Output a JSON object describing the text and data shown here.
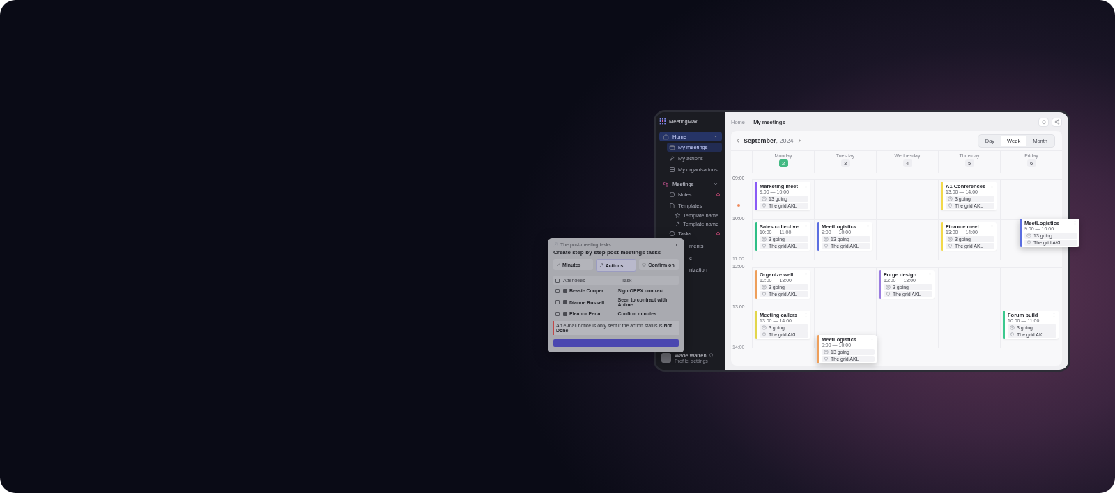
{
  "sidebar": {
    "logo": "MeetingMax",
    "nav": [
      {
        "label": "Home",
        "selected": true,
        "expanded": true,
        "children": [
          {
            "label": "My meetings",
            "selected": true,
            "alert": false
          },
          {
            "label": "My actions",
            "selected": false,
            "alert": false
          },
          {
            "label": "My organisations",
            "selected": false,
            "alert": false
          }
        ]
      },
      {
        "label": "Meetings",
        "selected": false,
        "expanded": true,
        "children": [
          {
            "label": "Notes",
            "selected": false,
            "alert": true
          },
          {
            "label": "Templates",
            "selected": false,
            "alert": false,
            "children": [
              {
                "label": "Template name"
              },
              {
                "label": "Template name"
              }
            ]
          },
          {
            "label": "Tasks",
            "selected": false,
            "alert": true
          }
        ]
      }
    ],
    "items_behind_dialog": [
      "ments",
      "e",
      "nization"
    ],
    "user": {
      "name": "Wade Warren",
      "subtitle": "Profile, settings"
    }
  },
  "breadcrumb": {
    "items": [
      "Home",
      "My meetings"
    ],
    "separator": "–"
  },
  "calendar": {
    "month": "September",
    "year": ", 2024",
    "views": [
      {
        "label": "Day",
        "selected": false
      },
      {
        "label": "Week",
        "selected": true
      },
      {
        "label": "Month",
        "selected": false
      }
    ],
    "days": [
      {
        "name": "Monday",
        "date": "2",
        "today": true
      },
      {
        "name": "Tuesday",
        "date": "3",
        "today": false
      },
      {
        "name": "Wednesday",
        "date": "4",
        "today": false
      },
      {
        "name": "Thursday",
        "date": "5",
        "today": false
      },
      {
        "name": "Friday",
        "date": "6",
        "today": false
      }
    ],
    "rows": [
      {
        "time": "09:00",
        "collapsed": false,
        "now": true,
        "slots": [
          {
            "kind": "event",
            "title": "Marketing meet",
            "time": "9:00 — 10:00",
            "attendees": "13 going",
            "location": "The grid AKL",
            "color": "#8b5cf6",
            "floating": false
          },
          {
            "kind": "empty"
          },
          {
            "kind": "empty"
          },
          {
            "kind": "event",
            "title": "A1 Conferences",
            "time": "13:00 — 14:00",
            "attendees": "3 going",
            "location": "The grid AKL",
            "color": "#f2d94a",
            "floating": false
          },
          {
            "kind": "empty"
          }
        ]
      },
      {
        "time": "10:00",
        "collapsed": false,
        "now": false,
        "slots": [
          {
            "kind": "event",
            "title": "Sales collective",
            "time": "10:00 — 11:00",
            "attendees": "3 going",
            "location": "The grid AKL",
            "color": "#2fbf86",
            "floating": false
          },
          {
            "kind": "event",
            "title": "MeetLogistics",
            "time": "9:00 — 10:00",
            "attendees": "13 going",
            "location": "The grid AKL",
            "color": "#5b6ee1",
            "floating": false
          },
          {
            "kind": "empty"
          },
          {
            "kind": "event",
            "title": "Finance meet",
            "time": "13:00 — 14:00",
            "attendees": "3 going",
            "location": "The grid AKL",
            "color": "#f2d94a",
            "floating": false
          },
          {
            "kind": "event",
            "title": "MeetLogistics",
            "time": "9:00 — 10:00",
            "attendees": "13 going",
            "location": "The grid AKL",
            "color": "#5b6ee1",
            "floating": true
          }
        ]
      },
      {
        "time": "11:00",
        "collapsed": true,
        "now": false,
        "slots": [
          {
            "kind": "empty"
          },
          {
            "kind": "empty"
          },
          {
            "kind": "empty"
          },
          {
            "kind": "empty"
          },
          {
            "kind": "empty"
          }
        ]
      },
      {
        "time": "12:00",
        "collapsed": false,
        "now": false,
        "slots": [
          {
            "kind": "event",
            "title": "Organize well",
            "time": "12:00 — 13:00",
            "attendees": "3 going",
            "location": "The grid AKL",
            "color": "#ee9f5b",
            "floating": false
          },
          {
            "kind": "empty"
          },
          {
            "kind": "event",
            "title": "Forge design",
            "time": "12:00 — 13:00",
            "attendees": "3 going",
            "location": "The grid AKL",
            "color": "#9b7de0",
            "floating": false
          },
          {
            "kind": "empty"
          },
          {
            "kind": "empty"
          }
        ]
      },
      {
        "time": "13:00",
        "collapsed": false,
        "now": false,
        "slots": [
          {
            "kind": "event",
            "title": "Meeting callers",
            "time": "13:00 — 14:00",
            "attendees": "3 going",
            "location": "The grid AKL",
            "color": "#e2d64c",
            "floating": false
          },
          {
            "kind": "event",
            "title": "MeetLogistics",
            "time": "9:00 — 10:00",
            "attendees": "13 going",
            "location": "The grid AKL",
            "color": "#ee9f5b",
            "floating": true
          },
          {
            "kind": "empty"
          },
          {
            "kind": "empty"
          },
          {
            "kind": "event",
            "title": "Forum build",
            "time": "10:00 — 11:00",
            "attendees": "3 going",
            "location": "The grid AKL",
            "color": "#3cc98f",
            "floating": false
          }
        ]
      },
      {
        "time": "14:00",
        "collapsed": true,
        "now": false,
        "slots": [
          {
            "kind": "empty"
          },
          {
            "kind": "empty"
          },
          {
            "kind": "empty"
          },
          {
            "kind": "empty"
          },
          {
            "kind": "empty"
          }
        ]
      }
    ]
  },
  "dialog": {
    "eyebrow": "The post-meeting tasks",
    "title": "Create step-by-step post-meetings tasks",
    "steps": [
      {
        "label": "Minutes",
        "selected": false,
        "done": true
      },
      {
        "label": "Actions",
        "selected": true,
        "done": false
      },
      {
        "label": "Confirm on",
        "selected": false,
        "done": false
      }
    ],
    "all_checked": false,
    "columns": [
      "Attendees",
      "Task"
    ],
    "rows": [
      {
        "name": "Bessie Cooper",
        "task": "Sign OPEX contract",
        "checked": false
      },
      {
        "name": "Dianne Russell",
        "task": "Seen to contract with Aptme",
        "checked": false
      },
      {
        "name": "Eleanor Pena",
        "task": "Confirm minutes",
        "checked": false
      }
    ],
    "notice": "An e-mail notice is only sent if the action status is **Not Done**"
  }
}
